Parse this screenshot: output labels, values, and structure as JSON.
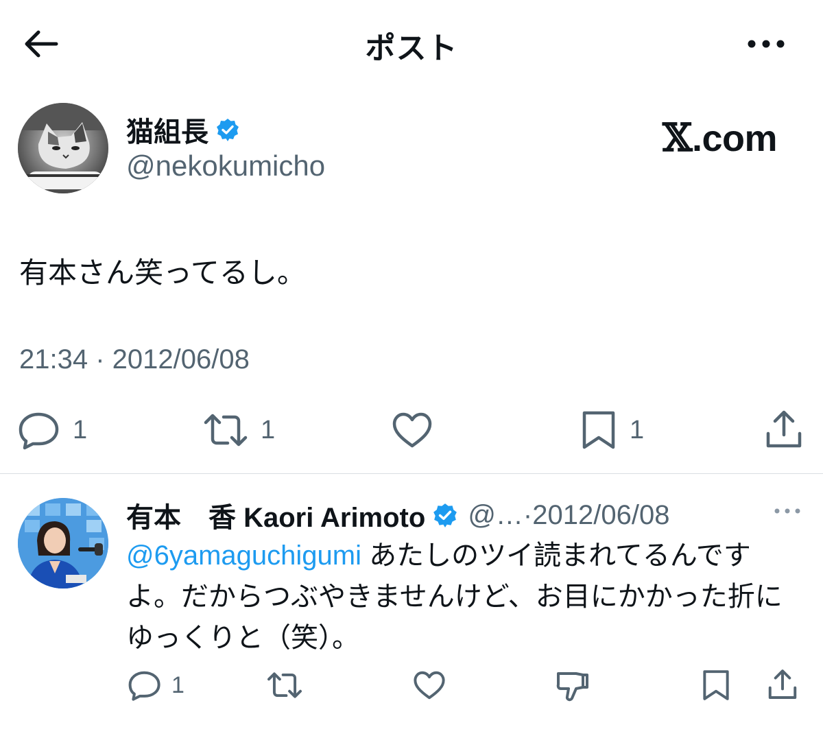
{
  "header": {
    "title": "ポスト",
    "back_icon": "arrow-left-icon",
    "more_icon": "more-horizontal-icon"
  },
  "post": {
    "display_name": "猫組長",
    "handle": "@nekokumicho",
    "verified": true,
    "watermark": {
      "mark": "𝕏",
      "suffix": ".com"
    },
    "text": "有本さん笑ってるし。",
    "timestamp": "21:34 · 2012/06/08",
    "actions": {
      "reply_count": "1",
      "repost_count": "1",
      "bookmark_count": "1"
    }
  },
  "reply": {
    "display_name": "有本　香  Kaori Arimoto",
    "handle": "@…",
    "separator": " · ",
    "date": "2012/06/08",
    "verified": true,
    "mention": "@6yamaguchigumi",
    "text": " あたしのツイ読まれてるんですよ。だからつぶやきませんけど、お目にかかった折にゆっくりと（笑）。",
    "actions": {
      "reply_count": "1"
    }
  },
  "colors": {
    "accent": "#1d9bf0",
    "text": "#0f1419",
    "secondary": "#536471",
    "divider": "#d9dee3"
  }
}
